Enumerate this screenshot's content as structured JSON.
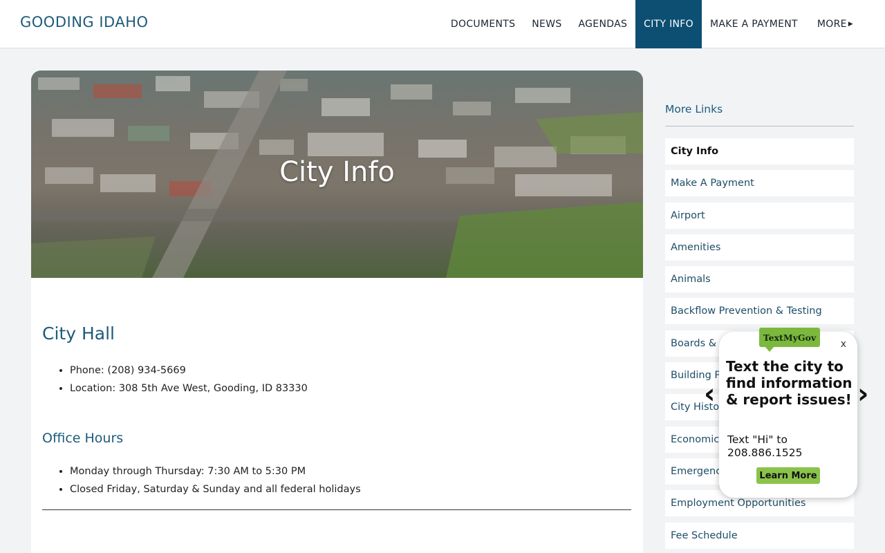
{
  "header": {
    "site_title": "GOODING IDAHO",
    "nav": [
      {
        "label": "DOCUMENTS"
      },
      {
        "label": "NEWS"
      },
      {
        "label": "AGENDAS"
      },
      {
        "label": "CITY INFO",
        "active": true
      },
      {
        "label": "MAKE A PAYMENT"
      },
      {
        "label": "MORE",
        "icon": "caret-right-icon"
      }
    ]
  },
  "hero": {
    "title": "City Info"
  },
  "content": {
    "city_hall_heading": "City Hall",
    "city_hall_items": [
      "Phone: (208) 934-5669",
      "Location: 308 5th Ave West, Gooding, ID 83330"
    ],
    "office_hours_heading": "Office Hours",
    "office_hours_items": [
      "Monday through Thursday: 7:30 AM to 5:30 PM",
      "Closed Friday, Saturday & Sunday and all federal holidays"
    ]
  },
  "sidebar": {
    "title": "More Links",
    "items": [
      {
        "label": "City Info",
        "current": true
      },
      {
        "label": "Make A Payment"
      },
      {
        "label": "Airport"
      },
      {
        "label": "Amenities"
      },
      {
        "label": "Animals"
      },
      {
        "label": "Backflow Prevention & Testing"
      },
      {
        "label": "Boards & Commissions"
      },
      {
        "label": "Building Permits"
      },
      {
        "label": "City History"
      },
      {
        "label": "Economic Development"
      },
      {
        "label": "Emergency Management"
      },
      {
        "label": "Employment Opportunities"
      },
      {
        "label": "Fee Schedule"
      }
    ]
  },
  "textmygov": {
    "logo": "TextMyGov",
    "close": "x",
    "heading": "Text the city to find information & report issues!",
    "body": "Text \"Hi\" to 208.886.1525",
    "button": "Learn More",
    "prev_arrow": "‹",
    "next_arrow": "›"
  },
  "colors": {
    "brand": "#1d5b7a",
    "nav_active_bg": "#0d4f72",
    "widget_green": "#8bc34a"
  }
}
